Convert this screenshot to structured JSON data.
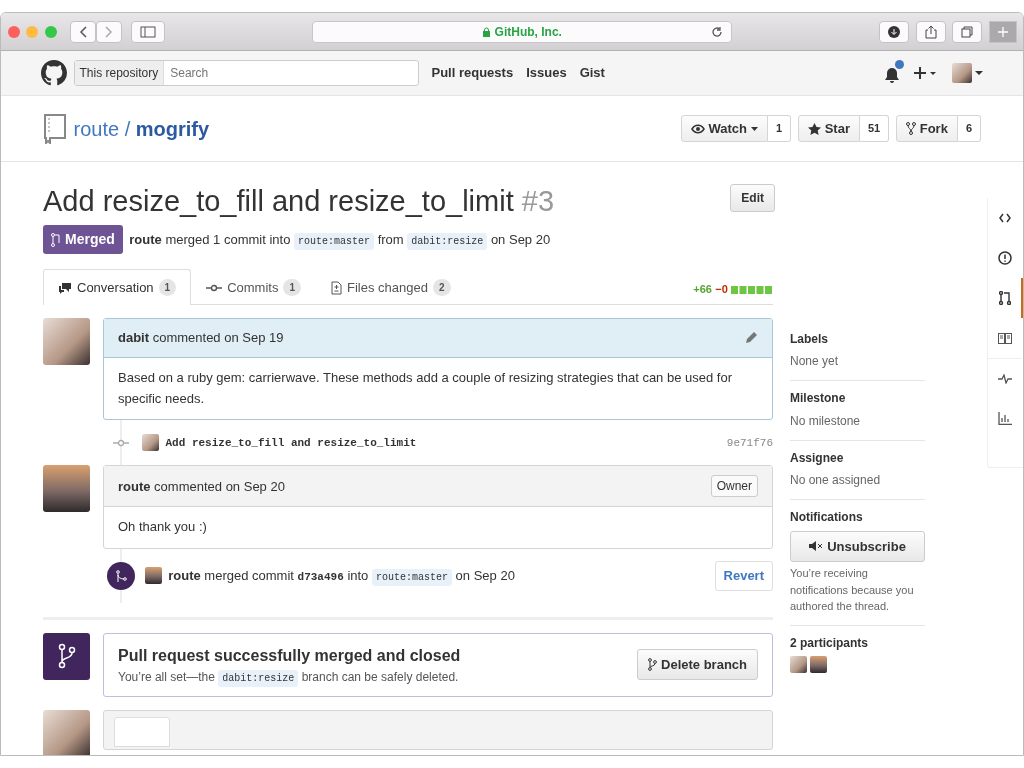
{
  "browser": {
    "address": "GitHub, Inc."
  },
  "header": {
    "scope": "This repository",
    "search_placeholder": "Search",
    "nav": [
      "Pull requests",
      "Issues",
      "Gist"
    ],
    "unread_notifications": true
  },
  "repo": {
    "owner": "route",
    "separator": "/",
    "name": "mogrify",
    "actions": [
      {
        "kind": "watch",
        "label": "Watch",
        "count": "1"
      },
      {
        "kind": "star",
        "label": "Star",
        "count": "51"
      },
      {
        "kind": "fork",
        "label": "Fork",
        "count": "6"
      }
    ]
  },
  "pull_request": {
    "title": "Add resize_to_fill and resize_to_limit",
    "number": "#3",
    "edit_label": "Edit",
    "state": "Merged",
    "summary": {
      "author": "route",
      "text": "merged 1 commit into",
      "base": "route:master",
      "from": "from",
      "head": "dabit:resize",
      "date": "on Sep 20"
    }
  },
  "tabs": [
    {
      "kind": "conversation",
      "label": "Conversation",
      "count": "1",
      "selected": true
    },
    {
      "kind": "commits",
      "label": "Commits",
      "count": "1",
      "selected": false
    },
    {
      "kind": "files",
      "label": "Files changed",
      "count": "2",
      "selected": false
    }
  ],
  "diffstat": {
    "additions": "+66",
    "deletions": "−0"
  },
  "timeline": [
    {
      "kind": "comment",
      "author": "dabit",
      "action": "commented on Sep 19",
      "highlighted": true,
      "body": "Based on a ruby gem: carrierwave. These methods add a couple of resizing strategies that can be used for specific needs."
    },
    {
      "kind": "commit",
      "message": "Add resize_to_fill and resize_to_limit",
      "sha": "9e71f76"
    },
    {
      "kind": "comment",
      "author": "route",
      "action": "commented on Sep 20",
      "highlighted": false,
      "role": "Owner",
      "body": "Oh thank you :)"
    },
    {
      "kind": "merge",
      "author": "route",
      "text": "merged commit",
      "sha": "d73a496",
      "into": "into",
      "base": "route:master",
      "date": "on Sep 20",
      "button": "Revert"
    }
  ],
  "merge_box": {
    "title": "Pull request successfully merged and closed",
    "text_before": "You’re all set—the",
    "branch": "dabit:resize",
    "text_after": "branch can be safely deleted.",
    "button": "Delete branch"
  },
  "sidebar": [
    {
      "kind": "text",
      "heading": "Labels",
      "value": "None yet"
    },
    {
      "kind": "text",
      "heading": "Milestone",
      "value": "No milestone"
    },
    {
      "kind": "text",
      "heading": "Assignee",
      "value": "No one assigned"
    },
    {
      "kind": "notifications",
      "heading": "Notifications",
      "button": "Unsubscribe",
      "note": "You’re receiving notifications because you authored the thread."
    },
    {
      "kind": "participants",
      "heading": "2 participants"
    }
  ],
  "repo_nav": [
    {
      "kind": "code",
      "selected": false
    },
    {
      "kind": "issues",
      "selected": false
    },
    {
      "kind": "pulls",
      "selected": true
    },
    {
      "kind": "wiki",
      "selected": false
    },
    {
      "kind": "pulse",
      "selected": false
    },
    {
      "kind": "graphs",
      "selected": false
    }
  ]
}
